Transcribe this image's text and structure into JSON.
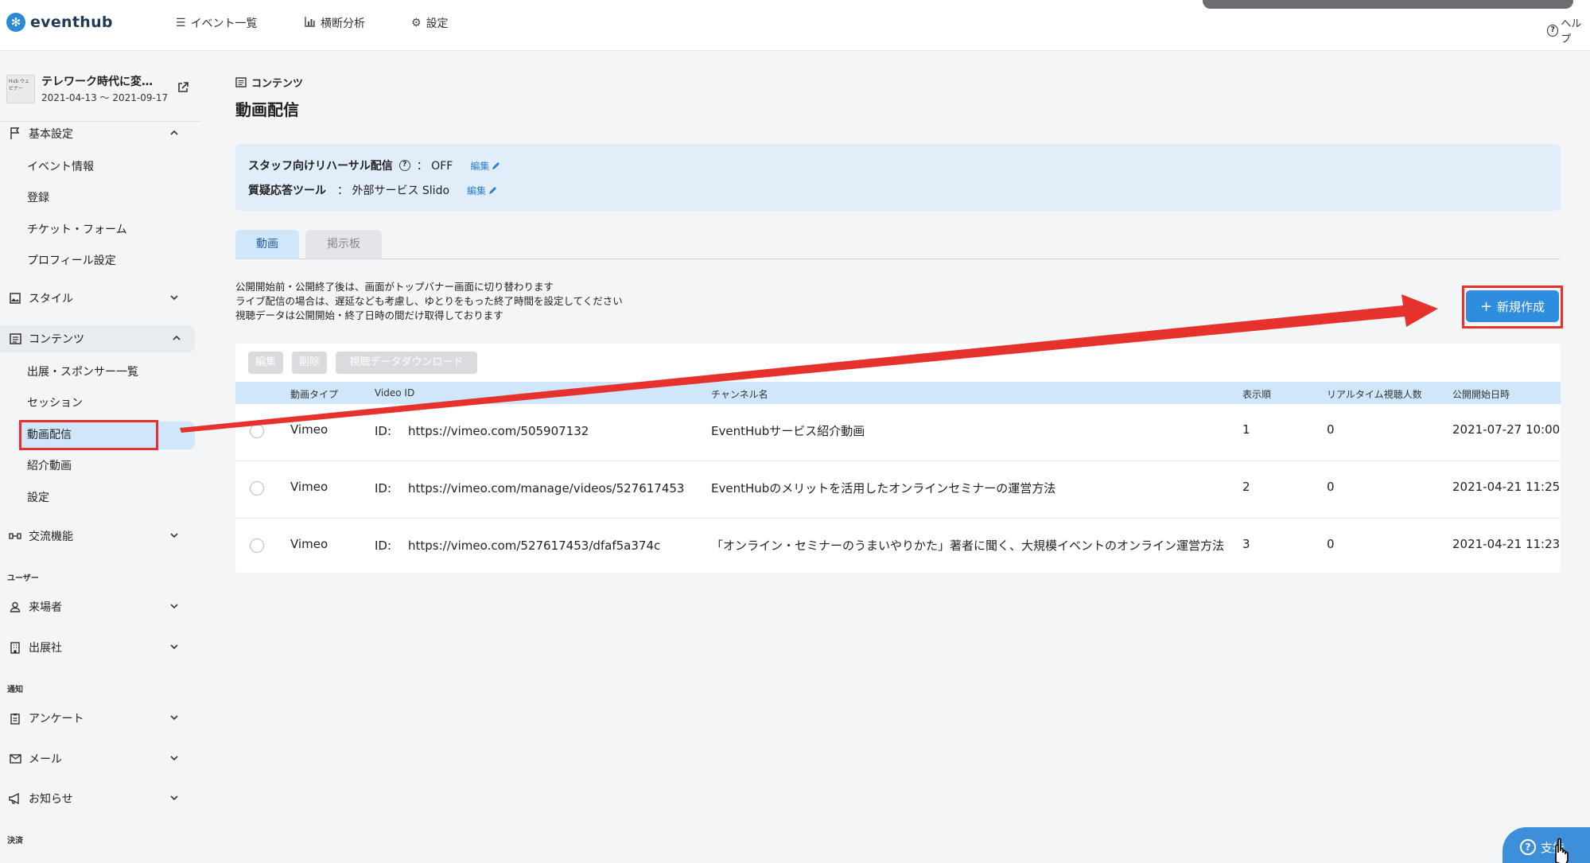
{
  "brand": {
    "name": "eventhub"
  },
  "topnav": {
    "items": [
      {
        "label": "イベント一覧"
      },
      {
        "label": "横断分析"
      },
      {
        "label": "設定"
      }
    ],
    "help_label": "ヘルプ"
  },
  "sidebar": {
    "event": {
      "title": "テレワーク時代に変…",
      "dates": "2021-04-13 ～ 2021-09-17",
      "thumb_text": "Hub ウェビナー"
    },
    "sections": {
      "basic": {
        "label": "基本設定",
        "items": [
          "イベント情報",
          "登録",
          "チケット・フォーム",
          "プロフィール設定"
        ]
      },
      "style": {
        "label": "スタイル"
      },
      "content": {
        "label": "コンテンツ",
        "items": [
          "出展・スポンサー一覧",
          "セッション",
          "動画配信",
          "紹介動画",
          "設定"
        ]
      },
      "exchange": {
        "label": "交流機能"
      },
      "group_user": "ユーザー",
      "visitors": {
        "label": "来場者"
      },
      "exhibitors": {
        "label": "出展社"
      },
      "group_notify": "通知",
      "survey": {
        "label": "アンケート"
      },
      "mail": {
        "label": "メール"
      },
      "news": {
        "label": "お知らせ"
      },
      "group_payment": "決済"
    }
  },
  "main": {
    "breadcrumb": "コンテンツ",
    "title": "動画配信",
    "info": {
      "rehearsal_label": "スタッフ向けリハーサル配信",
      "rehearsal_value": "：  OFF",
      "qa_label": "質疑応答ツール",
      "qa_value": "：  外部サービス Slido",
      "edit_label": "編集"
    },
    "tabs": [
      "動画",
      "掲示板"
    ],
    "notes": [
      "公開開始前・公開終了後は、画面がトップバナー画面に切り替わります",
      "ライブ配信の場合は、遅延なども考慮し、ゆとりをもった終了時間を設定してください",
      "視聴データは公開開始・終了日時の間だけ取得しております"
    ],
    "new_button": "新規作成",
    "bulk_actions": [
      "編集",
      "削除",
      "視聴データダウンロード"
    ],
    "table": {
      "headers": [
        "動画タイプ",
        "Video ID",
        "チャンネル名",
        "表示順",
        "リアルタイム視聴人数",
        "公開開始日時"
      ],
      "id_prefix": "ID:",
      "rows": [
        {
          "type": "Vimeo",
          "video_id": "https://vimeo.com/505907132",
          "channel": "EventHubサービス紹介動画",
          "order": "1",
          "realtime": "0",
          "start": "2021-07-27 10:00"
        },
        {
          "type": "Vimeo",
          "video_id": "https://vimeo.com/manage/videos/527617453",
          "channel": "EventHubのメリットを活用したオンラインセミナーの運営方法",
          "order": "2",
          "realtime": "0",
          "start": "2021-04-21 11:25"
        },
        {
          "type": "Vimeo",
          "video_id": "https://vimeo.com/527617453/dfaf5a374c",
          "channel": "「オンライン・セミナーのうまいやりかた」著者に聞く、大規模イベントのオンライン運営方法",
          "order": "3",
          "realtime": "0",
          "start": "2021-04-21 11:23"
        }
      ]
    }
  },
  "support_bubble": {
    "label": "支持"
  },
  "colors": {
    "accent": "#2f8de0",
    "annotation_red": "#e5322d",
    "active_bg": "#cfe6fb"
  }
}
